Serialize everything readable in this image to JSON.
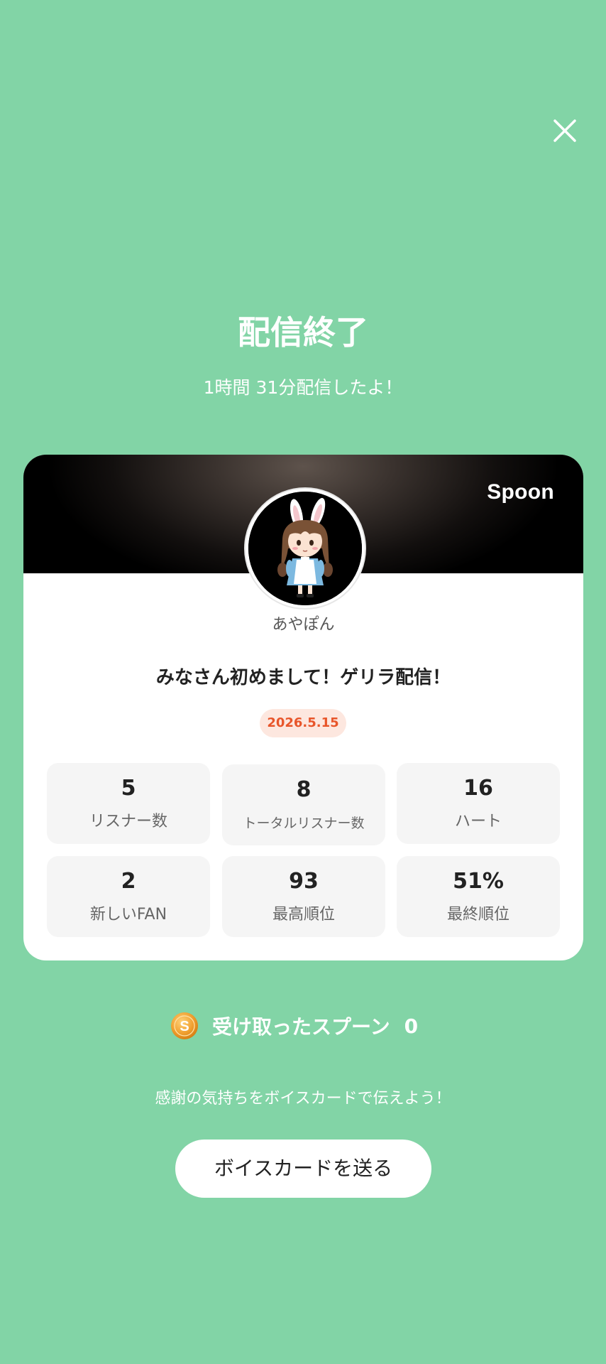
{
  "header": {
    "close_icon": "close-icon"
  },
  "summary": {
    "title": "配信終了",
    "subtitle": "1時間 31分配信したよ！"
  },
  "card": {
    "brand": "Spoon",
    "avatar_icon": "avatar-bunny-girl",
    "username": "あやぽん",
    "stream_title": "みなさん初めまして！ゲリラ配信！",
    "date": "2026.5.15",
    "stats": [
      {
        "value": "5",
        "label": "リスナー数"
      },
      {
        "value": "8",
        "label": "トータルリスナー数"
      },
      {
        "value": "16",
        "label": "ハート"
      },
      {
        "value": "2",
        "label": "新しいFAN"
      },
      {
        "value": "93",
        "label": "最高順位"
      },
      {
        "value": "51%",
        "label": "最終順位"
      }
    ]
  },
  "spoons": {
    "icon": "coin-icon",
    "coin_letter": "S",
    "label": "受け取ったスプーン",
    "count": "0"
  },
  "voice_card": {
    "message": "感謝の気持ちをボイスカードで伝えよう！",
    "button_label": "ボイスカードを送る"
  },
  "colors": {
    "background": "#82d4a6",
    "card": "#ffffff",
    "date_badge_bg": "#fde7df",
    "date_badge_text": "#e8552a",
    "stat_tile": "#f5f5f5",
    "coin": "#f0a030"
  }
}
